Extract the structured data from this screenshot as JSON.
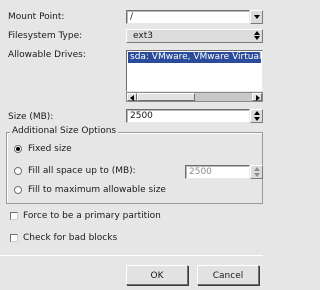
{
  "form": {
    "mount_point_label": "Mount Point:",
    "mount_point_value": "/",
    "fs_type_label": "Filesystem Type:",
    "fs_type_value": "ext3",
    "drives_label": "Allowable Drives:",
    "drives_items": [
      "sda: VMware, VMware Virtual S"
    ],
    "size_label": "Size (MB):",
    "size_value": "2500"
  },
  "options": {
    "title": "Additional Size Options",
    "fixed_label": "Fixed size",
    "fill_up_label": "Fill all space up to (MB):",
    "fill_up_value": "2500",
    "fill_max_label": "Fill to maximum allowable size",
    "selected": "fixed"
  },
  "checks": {
    "primary_label": "Force to be a primary partition",
    "badblocks_label": "Check for bad blocks",
    "primary_checked": false,
    "badblocks_checked": false
  },
  "buttons": {
    "ok": "OK",
    "cancel": "Cancel"
  }
}
